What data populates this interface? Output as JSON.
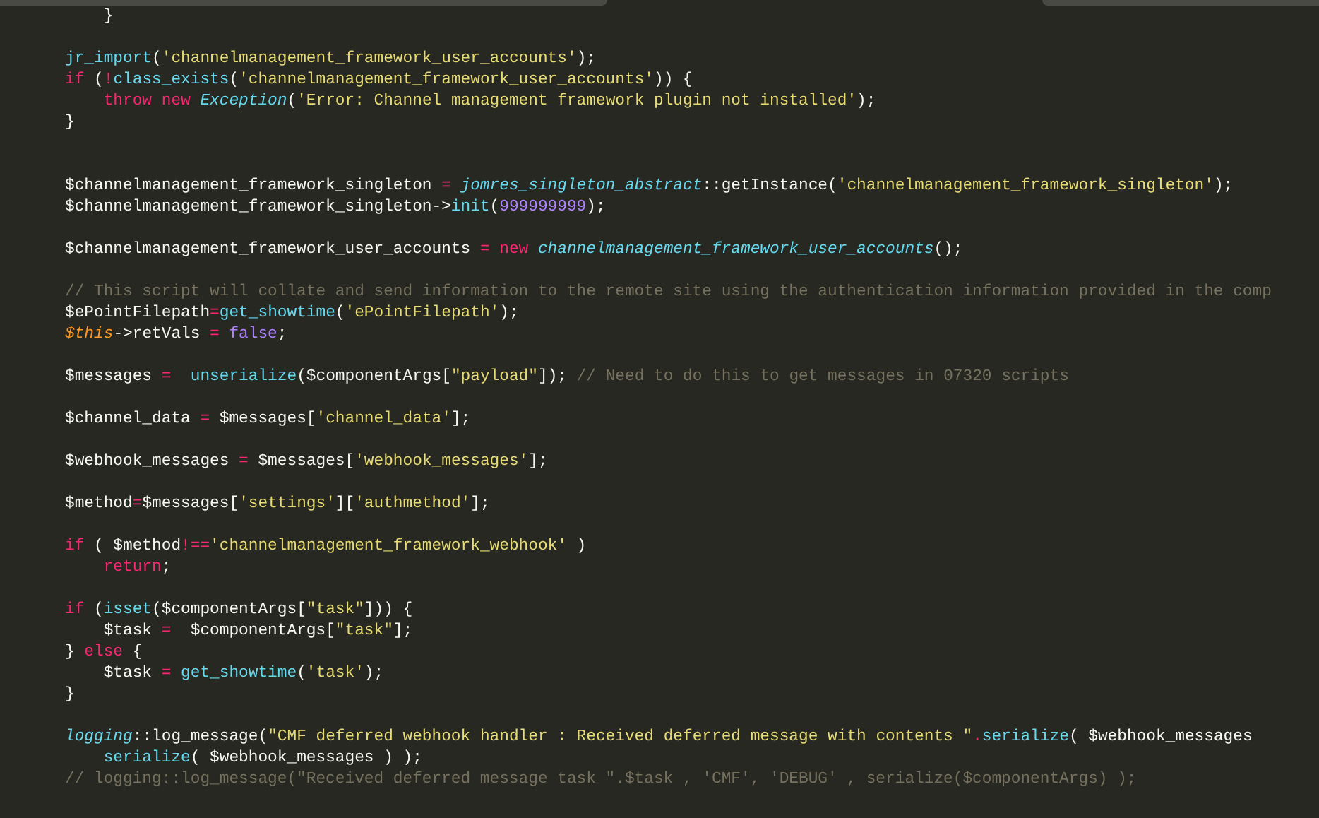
{
  "tabs": [
    {
      "selected": false
    }
  ],
  "lines": [
    {
      "kind": "code",
      "tokens": [
        {
          "kind": "plain",
          "text": "    }"
        }
      ]
    },
    {
      "kind": "blank"
    },
    {
      "kind": "code",
      "tokens": [
        {
          "kind": "func",
          "text": "jr_import"
        },
        {
          "kind": "plain",
          "text": "("
        },
        {
          "kind": "string",
          "text": "'channelmanagement_framework_user_accounts'"
        },
        {
          "kind": "plain",
          "text": ");"
        }
      ]
    },
    {
      "kind": "code",
      "tokens": [
        {
          "kind": "keyword",
          "text": "if"
        },
        {
          "kind": "plain",
          "text": " ("
        },
        {
          "kind": "keyword",
          "text": "!"
        },
        {
          "kind": "func",
          "text": "class_exists"
        },
        {
          "kind": "plain",
          "text": "("
        },
        {
          "kind": "string",
          "text": "'channelmanagement_framework_user_accounts'"
        },
        {
          "kind": "plain",
          "text": ")) {"
        }
      ]
    },
    {
      "kind": "code",
      "tokens": [
        {
          "kind": "keyword",
          "text": "    throw new "
        },
        {
          "kind": "class",
          "text": "Exception"
        },
        {
          "kind": "plain",
          "text": "("
        },
        {
          "kind": "string",
          "text": "'Error: Channel management framework plugin not installed'"
        },
        {
          "kind": "plain",
          "text": ");"
        }
      ]
    },
    {
      "kind": "code",
      "tokens": [
        {
          "kind": "plain",
          "text": "}"
        }
      ]
    },
    {
      "kind": "blank"
    },
    {
      "kind": "blank"
    },
    {
      "kind": "code",
      "tokens": [
        {
          "kind": "plain",
          "text": "$channelmanagement_framework_singleton "
        },
        {
          "kind": "keyword",
          "text": "= "
        },
        {
          "kind": "class",
          "text": "jomres_singleton_abstract"
        },
        {
          "kind": "plain",
          "text": "::getInstance("
        },
        {
          "kind": "string",
          "text": "'channelmanagement_framework_singleton'"
        },
        {
          "kind": "plain",
          "text": ");"
        }
      ]
    },
    {
      "kind": "code",
      "tokens": [
        {
          "kind": "plain",
          "text": "$channelmanagement_framework_singleton->"
        },
        {
          "kind": "func",
          "text": "init"
        },
        {
          "kind": "plain",
          "text": "("
        },
        {
          "kind": "number",
          "text": "999999999"
        },
        {
          "kind": "plain",
          "text": ");"
        }
      ]
    },
    {
      "kind": "blank"
    },
    {
      "kind": "code",
      "tokens": [
        {
          "kind": "plain",
          "text": "$channelmanagement_framework_user_accounts "
        },
        {
          "kind": "keyword",
          "text": "= new "
        },
        {
          "kind": "class",
          "text": "channelmanagement_framework_user_accounts"
        },
        {
          "kind": "plain",
          "text": "();"
        }
      ]
    },
    {
      "kind": "blank"
    },
    {
      "kind": "code",
      "tokens": [
        {
          "kind": "comment",
          "text": "// This script will collate and send information to the remote site using the authentication information provided in the comp"
        }
      ]
    },
    {
      "kind": "code",
      "tokens": [
        {
          "kind": "plain",
          "text": "$ePointFilepath"
        },
        {
          "kind": "keyword",
          "text": "="
        },
        {
          "kind": "func",
          "text": "get_showtime"
        },
        {
          "kind": "plain",
          "text": "("
        },
        {
          "kind": "string",
          "text": "'ePointFilepath'"
        },
        {
          "kind": "plain",
          "text": ");"
        }
      ]
    },
    {
      "kind": "code",
      "tokens": [
        {
          "kind": "this",
          "text": "$this"
        },
        {
          "kind": "plain",
          "text": "->retVals "
        },
        {
          "kind": "keyword",
          "text": "= "
        },
        {
          "kind": "number",
          "text": "false"
        },
        {
          "kind": "plain",
          "text": ";"
        }
      ]
    },
    {
      "kind": "blank"
    },
    {
      "kind": "code",
      "tokens": [
        {
          "kind": "plain",
          "text": "$messages "
        },
        {
          "kind": "keyword",
          "text": "=  "
        },
        {
          "kind": "func",
          "text": "unserialize"
        },
        {
          "kind": "plain",
          "text": "($componentArgs["
        },
        {
          "kind": "string",
          "text": "\"payload\""
        },
        {
          "kind": "plain",
          "text": "]); "
        },
        {
          "kind": "comment",
          "text": "// Need to do this to get messages in 07320 scripts"
        }
      ]
    },
    {
      "kind": "blank"
    },
    {
      "kind": "code",
      "tokens": [
        {
          "kind": "plain",
          "text": "$channel_data "
        },
        {
          "kind": "keyword",
          "text": "="
        },
        {
          "kind": "plain",
          "text": " $messages["
        },
        {
          "kind": "string",
          "text": "'channel_data'"
        },
        {
          "kind": "plain",
          "text": "];"
        }
      ]
    },
    {
      "kind": "blank"
    },
    {
      "kind": "code",
      "tokens": [
        {
          "kind": "plain",
          "text": "$webhook_messages "
        },
        {
          "kind": "keyword",
          "text": "="
        },
        {
          "kind": "plain",
          "text": " $messages["
        },
        {
          "kind": "string",
          "text": "'webhook_messages'"
        },
        {
          "kind": "plain",
          "text": "];"
        }
      ]
    },
    {
      "kind": "blank"
    },
    {
      "kind": "code",
      "tokens": [
        {
          "kind": "plain",
          "text": "$method"
        },
        {
          "kind": "keyword",
          "text": "="
        },
        {
          "kind": "plain",
          "text": "$messages["
        },
        {
          "kind": "string",
          "text": "'settings'"
        },
        {
          "kind": "plain",
          "text": "]["
        },
        {
          "kind": "string",
          "text": "'authmethod'"
        },
        {
          "kind": "plain",
          "text": "];"
        }
      ]
    },
    {
      "kind": "blank"
    },
    {
      "kind": "code",
      "tokens": [
        {
          "kind": "keyword",
          "text": "if"
        },
        {
          "kind": "plain",
          "text": " ( $method"
        },
        {
          "kind": "keyword",
          "text": "!=="
        },
        {
          "kind": "string",
          "text": "'channelmanagement_framework_webhook'"
        },
        {
          "kind": "plain",
          "text": " )"
        }
      ]
    },
    {
      "kind": "code",
      "tokens": [
        {
          "kind": "keyword",
          "text": "    return"
        },
        {
          "kind": "plain",
          "text": ";"
        }
      ]
    },
    {
      "kind": "blank"
    },
    {
      "kind": "code",
      "tokens": [
        {
          "kind": "keyword",
          "text": "if"
        },
        {
          "kind": "plain",
          "text": " ("
        },
        {
          "kind": "func",
          "text": "isset"
        },
        {
          "kind": "plain",
          "text": "($componentArgs["
        },
        {
          "kind": "string",
          "text": "\"task\""
        },
        {
          "kind": "plain",
          "text": "])) {"
        }
      ]
    },
    {
      "kind": "code",
      "tokens": [
        {
          "kind": "plain",
          "text": "    $task "
        },
        {
          "kind": "keyword",
          "text": "="
        },
        {
          "kind": "plain",
          "text": "  $componentArgs["
        },
        {
          "kind": "string",
          "text": "\"task\""
        },
        {
          "kind": "plain",
          "text": "];"
        }
      ]
    },
    {
      "kind": "code",
      "tokens": [
        {
          "kind": "plain",
          "text": "} "
        },
        {
          "kind": "keyword",
          "text": "else"
        },
        {
          "kind": "plain",
          "text": " {"
        }
      ]
    },
    {
      "kind": "code",
      "tokens": [
        {
          "kind": "plain",
          "text": "    $task "
        },
        {
          "kind": "keyword",
          "text": "= "
        },
        {
          "kind": "func",
          "text": "get_showtime"
        },
        {
          "kind": "plain",
          "text": "("
        },
        {
          "kind": "string",
          "text": "'task'"
        },
        {
          "kind": "plain",
          "text": ");"
        }
      ]
    },
    {
      "kind": "code",
      "tokens": [
        {
          "kind": "plain",
          "text": "}"
        }
      ]
    },
    {
      "kind": "blank"
    },
    {
      "kind": "code",
      "tokens": [
        {
          "kind": "class",
          "text": "logging"
        },
        {
          "kind": "plain",
          "text": "::log_message("
        },
        {
          "kind": "string",
          "text": "\"CMF deferred webhook handler : Received deferred message with contents \""
        },
        {
          "kind": "keyword",
          "text": "."
        },
        {
          "kind": "func",
          "text": "serialize"
        },
        {
          "kind": "plain",
          "text": "( $webhook_messages"
        }
      ]
    },
    {
      "kind": "code",
      "tokens": [
        {
          "kind": "func",
          "text": "    serialize"
        },
        {
          "kind": "plain",
          "text": "( $webhook_messages ) );"
        }
      ]
    },
    {
      "kind": "code",
      "tokens": [
        {
          "kind": "comment",
          "text": "// logging::log_message(\"Received deferred message task \".$task , 'CMF', 'DEBUG' , serialize($componentArgs) );"
        }
      ]
    }
  ]
}
